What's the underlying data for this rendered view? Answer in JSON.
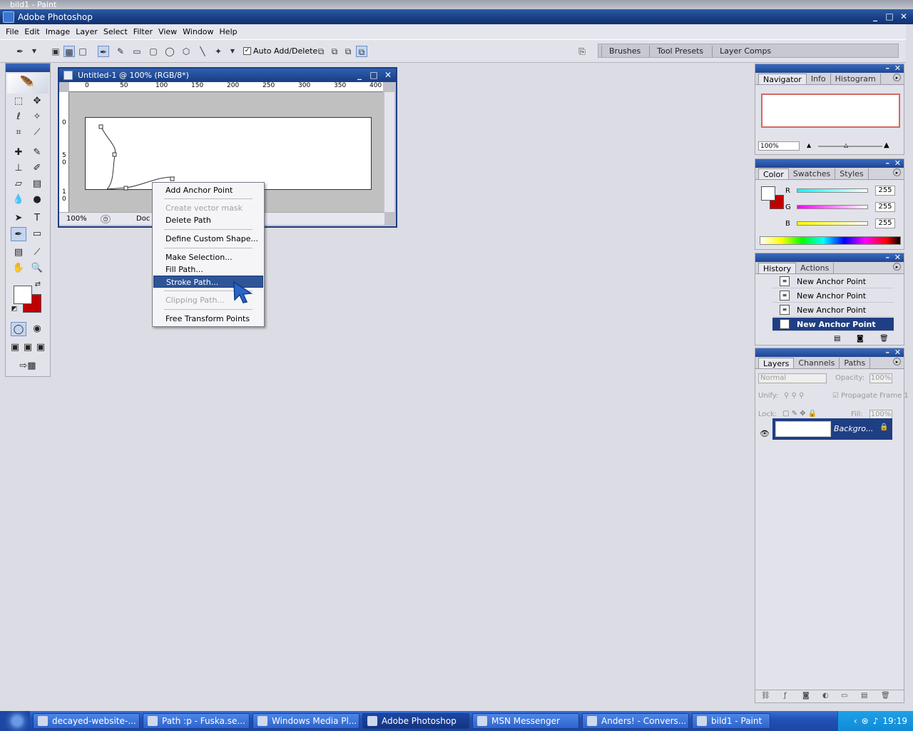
{
  "background_window": {
    "title": "bild1 - Paint"
  },
  "app": {
    "title": "Adobe Photoshop"
  },
  "menu": [
    "File",
    "Edit",
    "Image",
    "Layer",
    "Select",
    "Filter",
    "View",
    "Window",
    "Help"
  ],
  "options_bar": {
    "auto_add_label": "Auto Add/Delete",
    "auto_add_checked": true,
    "palette_well_tabs": [
      "Brushes",
      "Tool Presets",
      "Layer Comps"
    ]
  },
  "document": {
    "title": "Untitled-1 @ 100% (RGB/8*)",
    "ruler_top": [
      "0",
      "50",
      "100",
      "150",
      "200",
      "250",
      "300",
      "350",
      "400"
    ],
    "ruler_left": [
      "0",
      "5",
      "0",
      "1",
      "0"
    ],
    "zoom": "100%",
    "status": "Doc"
  },
  "context_menu": {
    "items": [
      {
        "label": "Add Anchor Point",
        "enabled": true
      },
      {
        "label": "Create vector mask",
        "enabled": false
      },
      {
        "label": "Delete Path",
        "enabled": true
      },
      {
        "label": "Define Custom Shape...",
        "enabled": true
      },
      {
        "label": "Make Selection...",
        "enabled": true
      },
      {
        "label": "Fill Path...",
        "enabled": true
      },
      {
        "label": "Stroke Path...",
        "enabled": true,
        "highlighted": true
      },
      {
        "label": "Clipping Path...",
        "enabled": false
      },
      {
        "label": "Free Transform Points",
        "enabled": true
      }
    ]
  },
  "navigator": {
    "tabs": [
      "Navigator",
      "Info",
      "Histogram"
    ],
    "zoom": "100%"
  },
  "color": {
    "tabs": [
      "Color",
      "Swatches",
      "Styles"
    ],
    "r_label": "R",
    "r": "255",
    "g_label": "G",
    "g": "255",
    "b_label": "B",
    "b": "255",
    "foreground": "#ffffff",
    "background": "#c00000"
  },
  "history": {
    "tabs": [
      "History",
      "Actions"
    ],
    "items": [
      "New Anchor Point",
      "New Anchor Point",
      "New Anchor Point",
      "New Anchor Point"
    ],
    "active_index": 3
  },
  "layers": {
    "tabs": [
      "Layers",
      "Channels",
      "Paths"
    ],
    "blend_mode": "Normal",
    "opacity_label": "Opacity:",
    "opacity": "100%",
    "unify_label": "Unify:",
    "propagate_label": "Propagate Frame 1",
    "lock_label": "Lock:",
    "fill_label": "Fill:",
    "fill": "100%",
    "layer_name": "Backgro..."
  },
  "taskbar": {
    "tasks": [
      "decayed-website-...",
      "Path :p - Fuska.se...",
      "Windows Media Pl...",
      "Adobe Photoshop",
      "MSN Messenger",
      "Anders! - Convers...",
      "bild1 - Paint"
    ],
    "active_index": 3,
    "clock": "19:19"
  }
}
